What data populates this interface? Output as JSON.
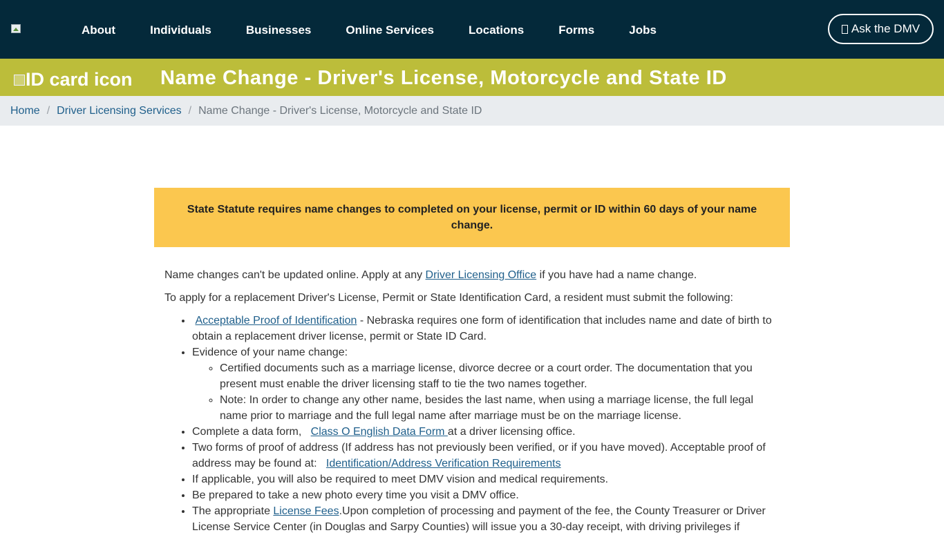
{
  "nav": {
    "logo_alt": "",
    "links": [
      "About",
      "Individuals",
      "Businesses",
      "Online Services",
      "Locations",
      "Forms",
      "Jobs"
    ],
    "ask_button": "Ask the DMV"
  },
  "title_bar": {
    "icon_alt": "ID card icon",
    "title": "Name Change - Driver's License, Motorcycle and State ID"
  },
  "breadcrumb": {
    "home": "Home",
    "parent": "Driver Licensing Services",
    "current": "Name Change - Driver's License, Motorcycle and State ID"
  },
  "alert": {
    "text": "State Statute requires name changes to completed on your license, permit or ID within 60 days of your name change."
  },
  "content": {
    "p1_before": "Name changes can't be updated online.  Apply at any ",
    "p1_link": "Driver Licensing Office",
    "p1_after": " if you have had a name change.",
    "p2": "To apply for a replacement Driver's License, Permit or State Identification Card, a resident must submit the following:",
    "item1_link": "Acceptable Proof of Identification",
    "item1_after": " - Nebraska requires one form of identification that includes name and date of birth to obtain a replacement driver license, permit or State ID Card.",
    "item2": "Evidence of your name change:",
    "item2_sub1": "Certified documents such as a marriage license, divorce decree or a court order. The documentation that you present must enable the driver licensing staff to tie the two names together.",
    "item2_sub2": "Note: In order to change any other name, besides the last name, when using a marriage license, the full legal name prior to marriage and the full legal name after marriage must be on the marriage license.",
    "item3_before": "Complete a data form,   ",
    "item3_link": "Class O English Data Form ",
    "item3_after": " at a driver licensing office.",
    "item4_before": "Two forms of proof of address (If address has not previously been verified, or if you have moved). Acceptable proof of address may be found at:   ",
    "item4_link": "Identification/Address Verification Requirements",
    "item5": "If applicable, you will also be required to meet DMV vision and medical requirements.",
    "item6": "Be prepared to take a new photo every time you visit a DMV office.",
    "item7_before": "The appropriate ",
    "item7_link": "License Fees",
    "item7_after": ".Upon completion of processing and payment of the fee, the County Treasurer or Driver License Service Center (in Douglas and Sarpy Counties) will issue you a 30-day receipt, with driving privileges if"
  }
}
